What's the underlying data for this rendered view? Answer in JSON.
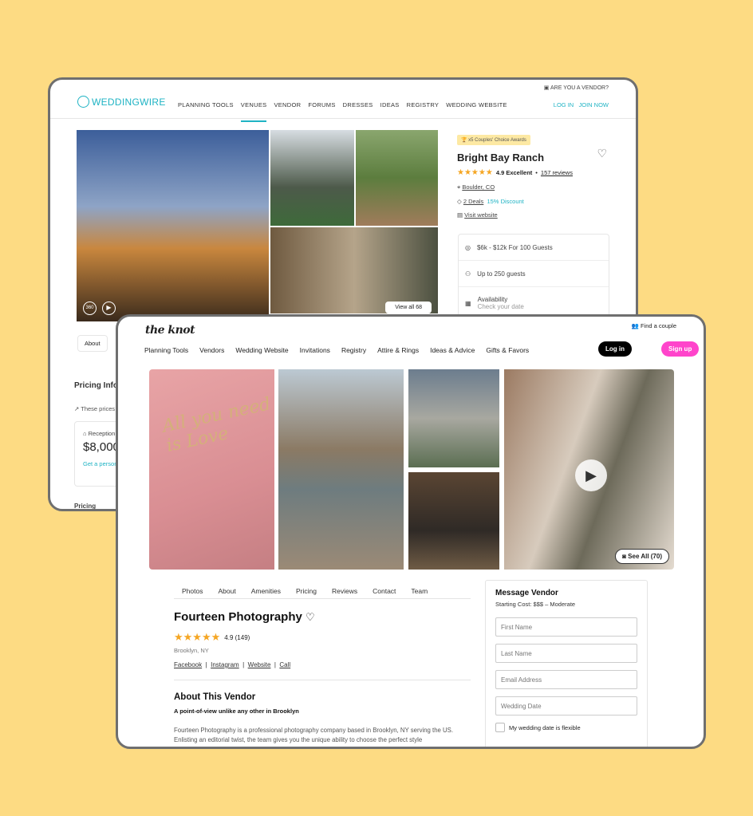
{
  "weddingwire": {
    "logo": "WEDDINGWIRE",
    "vendor_link": "ARE YOU A VENDOR?",
    "nav": [
      "PLANNING TOOLS",
      "VENUES",
      "VENDOR",
      "FORUMS",
      "DRESSES",
      "IDEAS",
      "REGISTRY",
      "WEDDING WEBSITE"
    ],
    "active_nav": "VENUES",
    "login": "LOG IN",
    "join": "JOIN NOW",
    "view_all": "View all 68",
    "award": "x5 Couples' Choice Awards",
    "venue_name": "Bright Bay Ranch",
    "rating": "4.9 Excellent",
    "reviews": "157 reviews",
    "location": "Boulder, CO",
    "deals": "2 Deals",
    "discount": "15% Discount",
    "website": "Visit website",
    "price": "$6k - $12k For 100 Guests",
    "capacity": "Up to 250 guests",
    "availability": "Availability",
    "availability_sub": "Check your date",
    "tab_about": "About",
    "pricing_heading": "Pricing Info",
    "pricing_note": "These prices",
    "reception": "Reception",
    "reception_price": "$8,000",
    "personalized": "Get a personalized",
    "pricing_footer": "Pricing",
    "accent": "#1fb3c4"
  },
  "knot": {
    "logo": "the knot",
    "find_couple": "Find a couple",
    "nav": [
      "Planning Tools",
      "Vendors",
      "Wedding Website",
      "Invitations",
      "Registry",
      "Attire & Rings",
      "Ideas & Advice",
      "Gifts & Favors"
    ],
    "login": "Log in",
    "signup": "Sign up",
    "see_all": "See All (70)",
    "tabs": [
      "Photos",
      "About",
      "Amenities",
      "Pricing",
      "Reviews",
      "Contact",
      "Team"
    ],
    "vendor_name": "Fourteen Photography",
    "rating": "4.9 (149)",
    "location": "Brooklyn, NY",
    "links": [
      "Facebook",
      "Instagram",
      "Website",
      "Call"
    ],
    "about_heading": "About This Vendor",
    "about_sub": "A point-of-view unlike any other in Brooklyn",
    "about_text": "Fourteen Photography is a professional photography company based in Brooklyn, NY serving the US. Enlisting an editorial twist, the team gives you the unique ability to choose the perfect style",
    "message": {
      "title": "Message Vendor",
      "cost_label": "Starting Cost:",
      "cost_value": "$$$ – Moderate",
      "fields": [
        "First Name",
        "Last Name",
        "Email Address",
        "Wedding Date"
      ],
      "flexible": "My wedding date is flexible"
    },
    "signup_color": "#ff44cb"
  }
}
